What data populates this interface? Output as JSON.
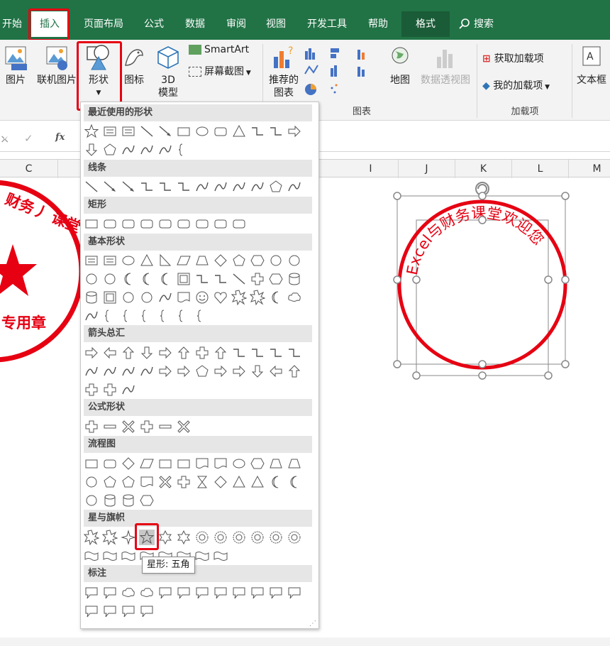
{
  "colors": {
    "accent": "#217346",
    "highlight": "#e60012",
    "stamp": "#e60012"
  },
  "tabs": [
    "开始",
    "插入",
    "页面布局",
    "公式",
    "数据",
    "审阅",
    "视图",
    "开发工具",
    "帮助",
    "格式"
  ],
  "search_label": "搜索",
  "ribbon": {
    "picture": "图片",
    "online_picture": "联机图片",
    "shapes": "形状",
    "icons": "图标",
    "model_3d": "3D",
    "model_3d_2": "模型",
    "smartart": "SmartArt",
    "screenshot": "屏幕截图",
    "recommended_charts": "推荐的",
    "recommended_charts_2": "图表",
    "map": "地图",
    "pivot_chart": "数据透视图",
    "get_addins": "获取加载项",
    "my_addins": "我的加载项",
    "textbox": "文本框",
    "group_charts": "图表",
    "group_addins": "加载项"
  },
  "formula_bar": {
    "cancel": "✕",
    "enter": "✓",
    "fx": "fx"
  },
  "columns": [
    "C",
    "I",
    "J",
    "K",
    "L",
    "M"
  ],
  "stamp_left": {
    "text_top": "财务丿 课堂",
    "text_bottom": "专用章"
  },
  "stamp_right": {
    "arc_text": "Excel与财务课堂欢迎您"
  },
  "shapes_menu": {
    "sections": [
      "最近使用的形状",
      "线条",
      "矩形",
      "基本形状",
      "箭头总汇",
      "公式形状",
      "流程图",
      "星与旗帜",
      "标注"
    ],
    "tooltip": "星形: 五角"
  }
}
